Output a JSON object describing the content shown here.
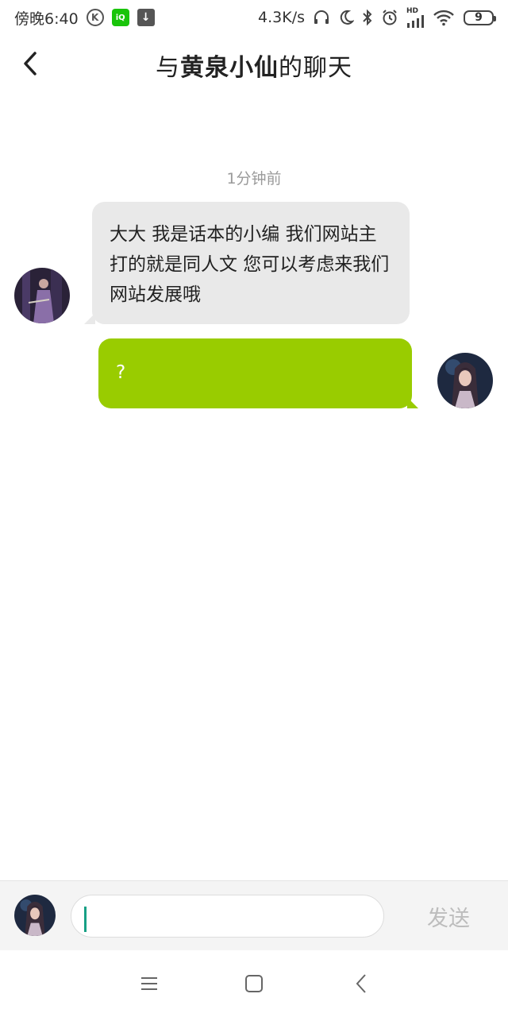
{
  "status_bar": {
    "time": "傍晚6:40",
    "speed": "4.3K/s",
    "battery": "9",
    "hd_label": "HD",
    "icons": [
      "k-icon",
      "iqiyi-icon",
      "download-icon",
      "headphone-icon",
      "moon-icon",
      "bluetooth-icon",
      "alarm-icon",
      "signal-icon",
      "wifi-icon",
      "battery-icon"
    ]
  },
  "header": {
    "title_prefix": "与",
    "title_name": "黄泉小仙",
    "title_suffix": "的聊天"
  },
  "chat": {
    "timestamp": "1分钟前",
    "messages": [
      {
        "side": "left",
        "text": "大大 我是话本的小编 我们网站主打的就是同人文 您可以考虑来我们网站发展哦",
        "bubble_color": "#e9e9e9"
      },
      {
        "side": "right",
        "text": "?",
        "bubble_color": "#99cc00"
      }
    ]
  },
  "input": {
    "value": "",
    "placeholder": "",
    "send_label": "发送"
  },
  "colors": {
    "accent_green": "#99cc00",
    "caret": "#17a085",
    "timestamp": "#9a9a9a"
  }
}
